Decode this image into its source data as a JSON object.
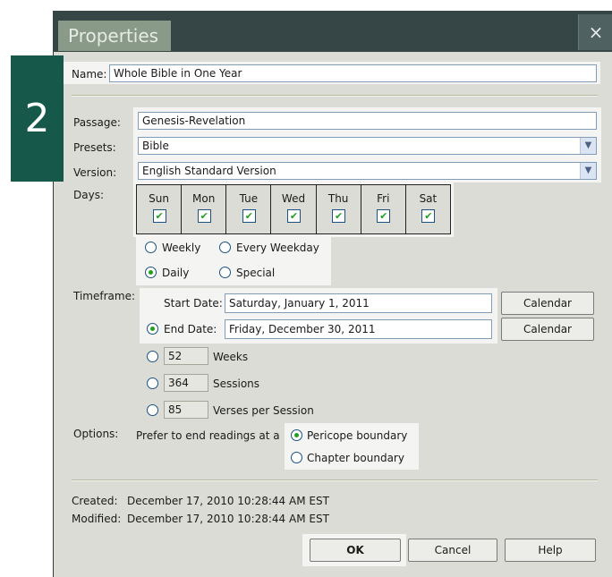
{
  "window": {
    "title": "Properties",
    "close_label": "×"
  },
  "step_badge": "2",
  "name": {
    "label": "Name:",
    "value": "Whole Bible in One Year"
  },
  "passage": {
    "label": "Passage:",
    "value": "Genesis-Revelation"
  },
  "presets": {
    "label": "Presets:",
    "value": "Bible"
  },
  "version": {
    "label": "Version:",
    "value": "English Standard Version"
  },
  "days": {
    "label": "Days:",
    "items": [
      {
        "name": "Sun",
        "checked": true
      },
      {
        "name": "Mon",
        "checked": true
      },
      {
        "name": "Tue",
        "checked": true
      },
      {
        "name": "Wed",
        "checked": true
      },
      {
        "name": "Thu",
        "checked": true
      },
      {
        "name": "Fri",
        "checked": true
      },
      {
        "name": "Sat",
        "checked": true
      }
    ],
    "check_glyph": "✔",
    "modes": {
      "weekly": "Weekly",
      "every_weekday": "Every Weekday",
      "daily": "Daily",
      "special": "Special"
    },
    "selected_mode": "daily"
  },
  "timeframe": {
    "label": "Timeframe:",
    "start_label": "Start Date:",
    "start_value": "Saturday, January 1, 2011",
    "end_label": "End Date:",
    "end_value": "Friday, December 30, 2011",
    "calendar_label": "Calendar",
    "weeks_value": "52",
    "weeks_label": "Weeks",
    "sessions_value": "364",
    "sessions_label": "Sessions",
    "verses_value": "85",
    "verses_label": "Verses per Session",
    "selected": "end_date"
  },
  "options": {
    "label": "Options:",
    "prefer_text": "Prefer to end readings at a",
    "pericope_label": "Pericope boundary",
    "chapter_label": "Chapter boundary",
    "selected": "pericope"
  },
  "info": {
    "created_label": "Created:",
    "created_value": "December 17, 2010 10:28:44 AM EST",
    "modified_label": "Modified:",
    "modified_value": "December 17, 2010 10:28:44 AM EST"
  },
  "buttons": {
    "ok": "OK",
    "cancel": "Cancel",
    "help": "Help"
  }
}
